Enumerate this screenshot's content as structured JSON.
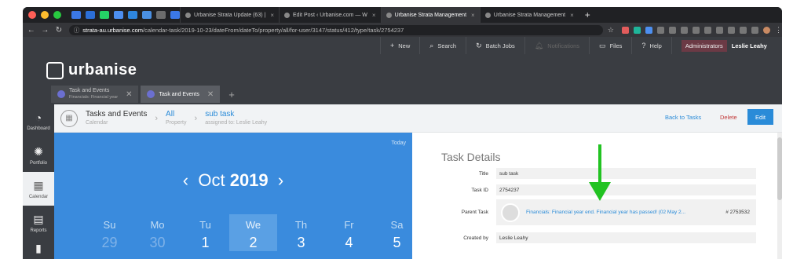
{
  "browser": {
    "tabs": [
      {
        "label": "Urbanise Strata Update (63) |"
      },
      {
        "label": "Edit Post ‹ Urbanise.com — W"
      },
      {
        "label": "Urbanise Strata Management"
      },
      {
        "label": "Urbanise Strata Management"
      }
    ],
    "url_host": "strata-au.urbanise.com",
    "url_path": "/calendar-task/2019-10-23/dateFrom/dateTo/property/all/for-user/3147/status/412/type/task/2754237"
  },
  "app": {
    "logo": "urbanise",
    "topnav": {
      "new": "New",
      "search": "Search",
      "batch": "Batch Jobs",
      "notifications": "Notifications",
      "files": "Files",
      "help": "Help",
      "role": "Administrators",
      "user": "Leslie Leahy"
    },
    "tabs": [
      {
        "label": "Task and Events",
        "sub": "Financials: Financial year"
      },
      {
        "label": "Task and Events"
      }
    ]
  },
  "sidebar": {
    "items": [
      {
        "label": "Dashboard"
      },
      {
        "label": "Portfolio"
      },
      {
        "label": "Calendar"
      },
      {
        "label": "Reports"
      }
    ]
  },
  "breadcrumb": {
    "c1": {
      "main": "Tasks and Events",
      "sub": "Calendar"
    },
    "c2": {
      "main": "All",
      "sub": "Property"
    },
    "c3": {
      "main": "sub task",
      "sub": "assigned to: Leslie Leahy"
    },
    "back": "Back to Tasks",
    "delete": "Delete",
    "edit": "Edit"
  },
  "calendar": {
    "today": "Today",
    "month": "Oct",
    "year": "2019",
    "prev": "‹",
    "next": "›",
    "weekdays": [
      "Su",
      "Mo",
      "Tu",
      "We",
      "Th",
      "Fr",
      "Sa"
    ],
    "dates": [
      "29",
      "30",
      "1",
      "2",
      "3",
      "4",
      "5"
    ]
  },
  "task": {
    "heading": "Task Details",
    "title_label": "Title",
    "title": "sub task",
    "id_label": "Task ID",
    "id": "2754237",
    "parent_label": "Parent Task",
    "parent": "Financials: Financial year end. Financial year has passed! (02 May 2...",
    "parent_id": "# 2753532",
    "created_label": "Created by",
    "created": "Leslie Leahy"
  },
  "colors": {
    "accent": "#2a8bd8",
    "calendar": "#3a8bdd",
    "arrow": "#22c322"
  }
}
